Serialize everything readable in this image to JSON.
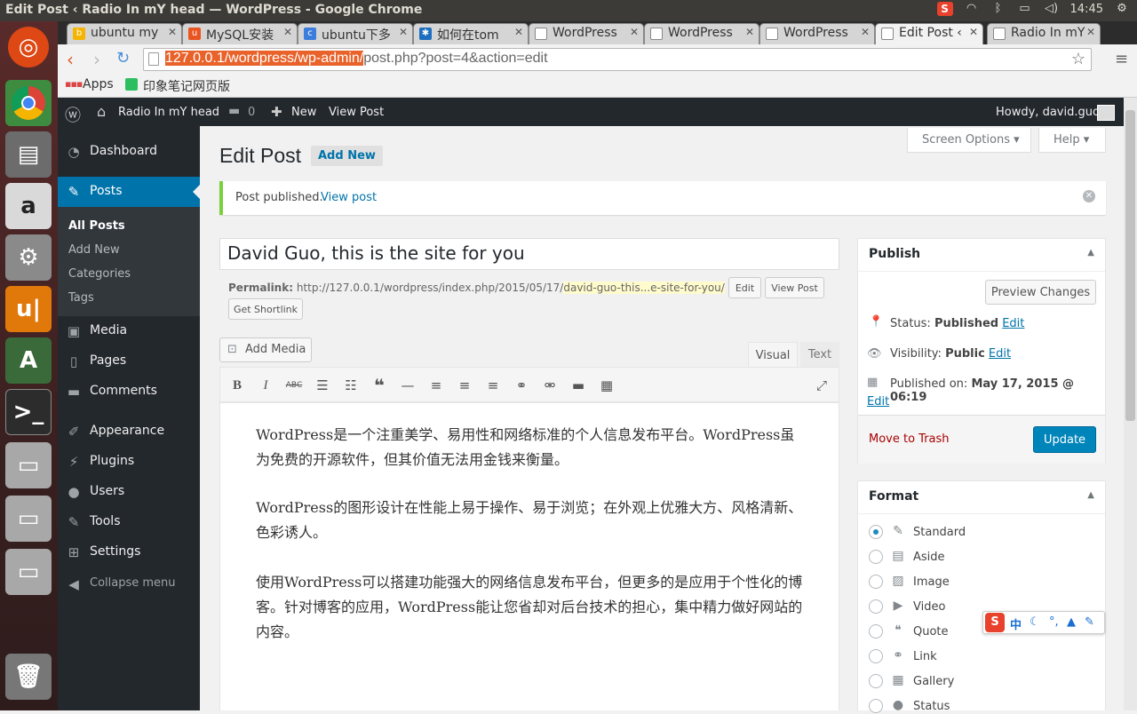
{
  "os": {
    "window_title": "Edit Post ‹ Radio In mY head — WordPress - Google Chrome",
    "time": "14:45"
  },
  "tabs": [
    {
      "label": "ubuntu my",
      "icon": "bing-icon",
      "color": "#f4b400"
    },
    {
      "label": "MySQL安装",
      "icon": "ubuntu-icon",
      "color": "#e95420"
    },
    {
      "label": "ubuntu下多",
      "icon": "chrome-icon",
      "color": "#3b7ddd"
    },
    {
      "label": "如何在tom",
      "icon": "zhihu-icon",
      "color": "#1e6fbf"
    },
    {
      "label": "WordPress",
      "icon": "page-icon",
      "color": "#ffffff"
    },
    {
      "label": "WordPress",
      "icon": "page-icon",
      "color": "#ffffff"
    },
    {
      "label": "WordPress",
      "icon": "page-icon",
      "color": "#ffffff"
    },
    {
      "label": "Edit Post ‹",
      "icon": "page-icon",
      "color": "#ffffff"
    },
    {
      "label": "Radio In mY",
      "icon": "page-icon",
      "color": "#ffffff"
    }
  ],
  "browser": {
    "url_highlight": "127.0.0.1/wordpress/wp-admin/",
    "url_rest": "post.php?post=4&action=edit"
  },
  "bookmarks": {
    "apps": "Apps",
    "item1": "印象笔记网页版"
  },
  "adminbar": {
    "site": "Radio In mY head",
    "comments": "0",
    "new": "New",
    "view_post": "View Post",
    "howdy": "Howdy, david.guo"
  },
  "menu": {
    "dashboard": "Dashboard",
    "posts": "Posts",
    "sub": [
      "All Posts",
      "Add New",
      "Categories",
      "Tags"
    ],
    "media": "Media",
    "pages": "Pages",
    "comments": "Comments",
    "appearance": "Appearance",
    "plugins": "Plugins",
    "users": "Users",
    "tools": "Tools",
    "settings": "Settings",
    "collapse": "Collapse menu"
  },
  "header": {
    "title": "Edit Post",
    "add_new": "Add New",
    "screen_options": "Screen Options",
    "help": "Help"
  },
  "notice": {
    "text": "Post published.",
    "link": "View post"
  },
  "post": {
    "title": "David Guo, this is the site for you",
    "permalink_label": "Permalink:",
    "permalink_base": "http://127.0.0.1/wordpress/index.php/2015/05/17/",
    "permalink_slug": "david-guo-this...e-site-for-you/",
    "edit_btn": "Edit",
    "view_post_btn": "View Post",
    "shortlink_btn": "Get Shortlink",
    "add_media": "Add Media",
    "visual_tab": "Visual",
    "text_tab": "Text",
    "paragraphs": [
      "WordPress是一个注重美学、易用性和网络标准的个人信息发布平台。WordPress虽为免费的开源软件，但其价值无法用金钱来衡量。",
      "WordPress的图形设计在性能上易于操作、易于浏览；在外观上优雅大方、风格清新、色彩诱人。",
      "使用WordPress可以搭建功能强大的网络信息发布平台，但更多的是应用于个性化的博客。针对博客的应用，WordPress能让您省却对后台技术的担心，集中精力做好网站的内容。"
    ]
  },
  "publish": {
    "title": "Publish",
    "preview": "Preview Changes",
    "status_label": "Status:",
    "status_value": "Published",
    "visibility_label": "Visibility:",
    "visibility_value": "Public",
    "published_label": "Published on:",
    "published_value": "May 17, 2015 @ 06:19",
    "edit": "Edit",
    "trash": "Move to Trash",
    "update": "Update"
  },
  "format": {
    "title": "Format",
    "options": [
      "Standard",
      "Aside",
      "Image",
      "Video",
      "Quote",
      "Link",
      "Gallery",
      "Status"
    ],
    "selected": "Standard"
  },
  "colors": {
    "wp_dark": "#23282d",
    "wp_blue": "#0073aa",
    "update_btn": "#0085ba",
    "notice_green": "#7ad03a",
    "launcher": "#5a2a2a"
  }
}
